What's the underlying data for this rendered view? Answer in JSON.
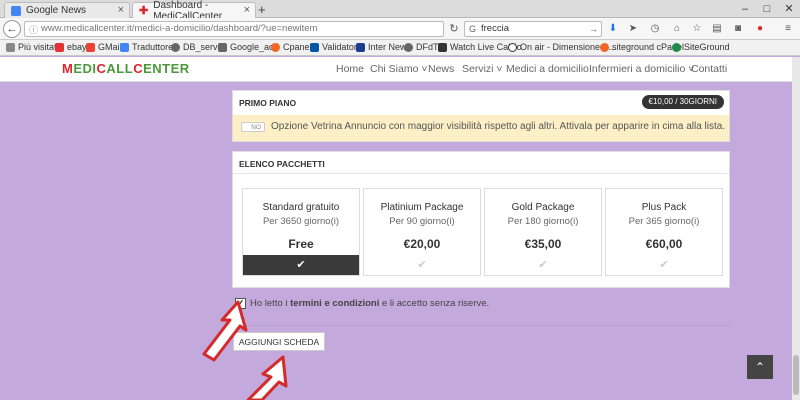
{
  "browser": {
    "tabs": [
      {
        "title": "Google News"
      },
      {
        "title": "Dashboard - MediCallCenter"
      }
    ],
    "url": "www.medicallcenter.it/medici-a-domicilio/dashboard/?ue=newitem",
    "search_value": "freccia"
  },
  "bookmarks": [
    "Più visitati",
    "ebay",
    "GMail",
    "Traduttore",
    "DB_server",
    "Google_add",
    "Cpanel",
    "Validator",
    "Inter News",
    "DFdT",
    "Watch Live Calcio",
    "On air - Dimensione S...",
    "siteground cPanel",
    "SiteGround"
  ],
  "site": {
    "logo_parts": [
      "M",
      "EDI",
      "C",
      "ALL",
      "C",
      "ENTER"
    ],
    "nav": [
      "Home",
      "Chi Siamo ˅",
      "News",
      "Servizi ˅",
      "Medici a domicilio",
      "Infermieri a domicilio ˅",
      "Contatti"
    ]
  },
  "primo_piano": {
    "header": "PRIMO PIANO",
    "price_badge": "€10,00 / 30GIORNI",
    "toggle_label": "NO",
    "text": "Opzione Vetrina Annuncio con maggior visibilità rispetto agli altri. Attivala per apparire in cima alla lista."
  },
  "pacchetti": {
    "header": "ELENCO PACCHETTI",
    "items": [
      {
        "name": "Standard gratuito",
        "period": "Per 3650 giorno(i)",
        "price": "Free",
        "selected": true
      },
      {
        "name": "Platinium Package",
        "period": "Per 90 giorno(i)",
        "price": "€20,00",
        "selected": false
      },
      {
        "name": "Gold Package",
        "period": "Per 180 giorno(i)",
        "price": "€35,00",
        "selected": false
      },
      {
        "name": "Plus Pack",
        "period": "Per 365 giorno(i)",
        "price": "€60,00",
        "selected": false
      }
    ]
  },
  "terms": {
    "prefix": "Ho letto i",
    "link": "termini e condizioni",
    "suffix": "e li accetto senza riserve.",
    "checked": true
  },
  "add_button": "AGGIUNGI SCHEDA"
}
